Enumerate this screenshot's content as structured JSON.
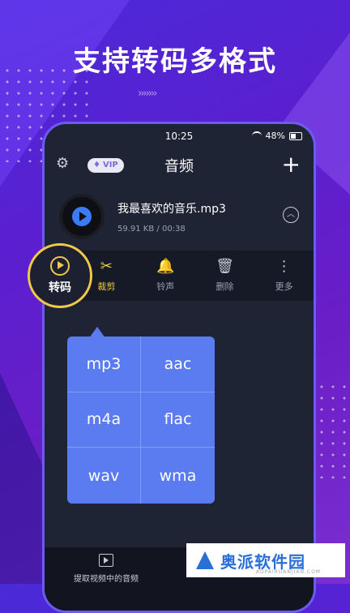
{
  "headline": "支持转码多格式",
  "chevrons": "›››››››",
  "status": {
    "time": "10:25",
    "battery": "48%"
  },
  "appbar": {
    "vip_label": "VIP",
    "title": "音频",
    "add_icon": "+"
  },
  "file": {
    "name": "我最喜欢的音乐.mp3",
    "meta": "59.91 KB / 00:38"
  },
  "actions": [
    {
      "name": "transcode",
      "label": "转码",
      "icon": "⟲"
    },
    {
      "name": "cut",
      "label": "裁剪",
      "icon": "✂"
    },
    {
      "name": "ringtone",
      "label": "铃声",
      "icon": "🔔"
    },
    {
      "name": "delete",
      "label": "删除",
      "icon": "🗑"
    },
    {
      "name": "more",
      "label": "更多",
      "icon": "⋮"
    }
  ],
  "formats": [
    "mp3",
    "aac",
    "m4a",
    "flac",
    "wav",
    "wma"
  ],
  "bottom": {
    "extract_label": "提取视频中的音频"
  },
  "watermark": {
    "text": "奥派软件园",
    "sub": "AOPAIRUANJIAN.COM"
  },
  "colors": {
    "accent": "#f1c94a",
    "menu": "#5b7bf0",
    "bg": "#5b1fd0"
  }
}
